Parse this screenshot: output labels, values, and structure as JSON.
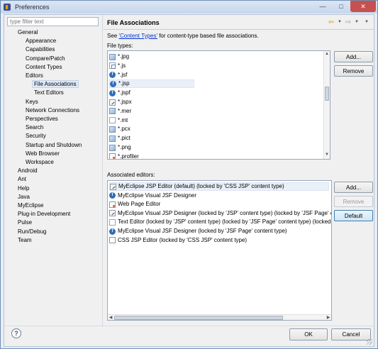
{
  "window": {
    "title": "Preferences",
    "controls": {
      "minimize": "—",
      "maximize": "□",
      "close": "✕"
    }
  },
  "filter": {
    "placeholder": "type filter text"
  },
  "tree": [
    {
      "label": "General",
      "level": 0
    },
    {
      "label": "Appearance",
      "level": 1
    },
    {
      "label": "Capabilities",
      "level": 1
    },
    {
      "label": "Compare/Patch",
      "level": 1
    },
    {
      "label": "Content Types",
      "level": 1
    },
    {
      "label": "Editors",
      "level": 1
    },
    {
      "label": "File Associations",
      "level": 2,
      "selected": true
    },
    {
      "label": "Text Editors",
      "level": 2
    },
    {
      "label": "Keys",
      "level": 1
    },
    {
      "label": "Network Connections",
      "level": 1
    },
    {
      "label": "Perspectives",
      "level": 1
    },
    {
      "label": "Search",
      "level": 1
    },
    {
      "label": "Security",
      "level": 1
    },
    {
      "label": "Startup and Shutdown",
      "level": 1
    },
    {
      "label": "Web Browser",
      "level": 1
    },
    {
      "label": "Workspace",
      "level": 1
    },
    {
      "label": "Android",
      "level": 0
    },
    {
      "label": "Ant",
      "level": 0
    },
    {
      "label": "Help",
      "level": 0
    },
    {
      "label": "Java",
      "level": 0
    },
    {
      "label": "MyEclipse",
      "level": 0
    },
    {
      "label": "Plug-in Development",
      "level": 0
    },
    {
      "label": "Pulse",
      "level": 0
    },
    {
      "label": "Run/Debug",
      "level": 0
    },
    {
      "label": "Team",
      "level": 0
    }
  ],
  "page": {
    "title": "File Associations",
    "see_prefix": "See ",
    "see_link": "'Content Types'",
    "see_suffix": " for content-type based file associations.",
    "file_types_label": "File types:",
    "editors_label": "Associated editors:"
  },
  "file_types": [
    {
      "name": "*.jpg",
      "icon": "image-icon"
    },
    {
      "name": "*.js",
      "icon": "javascript-file-icon"
    },
    {
      "name": "*.jsf",
      "icon": "jsf-icon"
    },
    {
      "name": "*.jsp",
      "icon": "jsf-icon",
      "selected": true
    },
    {
      "name": "*.jspf",
      "icon": "jsf-icon"
    },
    {
      "name": "*.jspx",
      "icon": "jsp-editor-icon"
    },
    {
      "name": "*.mer",
      "icon": "image-icon"
    },
    {
      "name": "*.mt",
      "icon": "document-icon"
    },
    {
      "name": "*.pcx",
      "icon": "image-icon"
    },
    {
      "name": "*.pict",
      "icon": "image-icon"
    },
    {
      "name": "*.png",
      "icon": "image-icon"
    },
    {
      "name": "*.profiler",
      "icon": "web-page-icon"
    }
  ],
  "editors": [
    {
      "name": "MyEclipse JSP Editor (default) (locked by 'CSS JSP' content type)",
      "icon": "jsp-editor-icon",
      "selected": true
    },
    {
      "name": "MyEclipse Visual JSF Designer",
      "icon": "jsf-icon"
    },
    {
      "name": "Web Page Editor",
      "icon": "web-page-icon"
    },
    {
      "name": "MyEclipse Visual JSP Designer (locked by 'JSP' content type) (locked by 'JSF Page' co",
      "icon": "jsp-editor-icon"
    },
    {
      "name": "Text Editor (locked by 'JSP' content type) (locked by 'JSF Page' content type) (locked",
      "icon": "document-icon"
    },
    {
      "name": "MyEclipse Visual JSF Designer (locked by 'JSF Page' content type)",
      "icon": "jsf-icon"
    },
    {
      "name": "CSS JSP Editor (locked by 'CSS JSP' content type)",
      "icon": "css-file-icon"
    }
  ],
  "buttons": {
    "add_file_type": "Add...",
    "remove_file_type": "Remove",
    "add_editor": "Add...",
    "remove_editor": "Remove",
    "default_editor": "Default",
    "ok": "OK",
    "cancel": "Cancel"
  },
  "help": {
    "glyph": "?"
  },
  "colors": {
    "accent": "#0033cc",
    "selection": "#dfe9f7",
    "default_button": "#cfe5f7"
  }
}
